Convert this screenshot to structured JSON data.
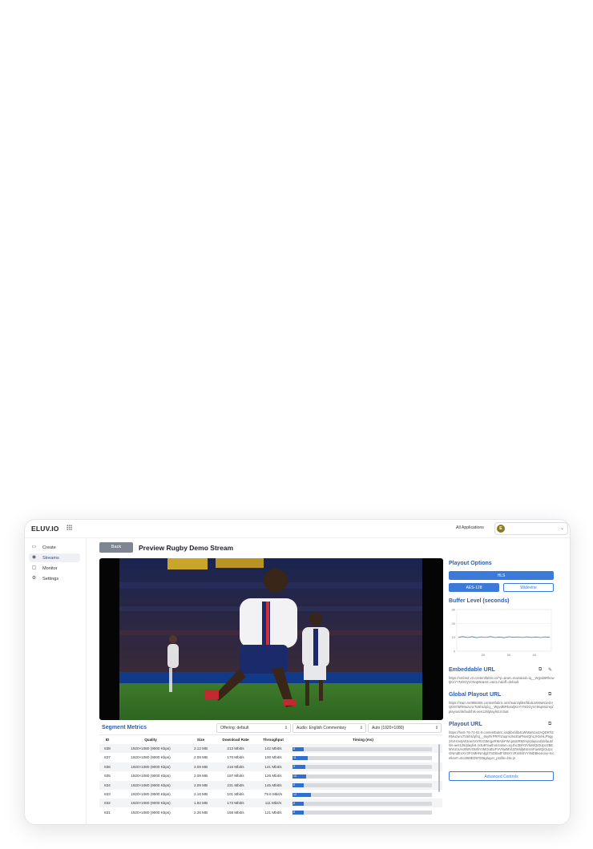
{
  "header": {
    "logo": "ELUV.IO",
    "all_apps": "All Applications",
    "user_initial": "E"
  },
  "sidebar": {
    "items": [
      {
        "label": "Create",
        "icon": "video-camera-icon"
      },
      {
        "label": "Streams",
        "icon": "broadcast-icon"
      },
      {
        "label": "Monitor",
        "icon": "monitor-icon"
      },
      {
        "label": "Settings",
        "icon": "gear-icon"
      }
    ]
  },
  "page": {
    "back_label": "Back",
    "title": "Preview Rugby Demo Stream"
  },
  "metrics": {
    "title": "Segment Metrics",
    "selects": {
      "offering": "Offering: default",
      "audio": "Audio: English Commentary",
      "quality": "Auto (1920×1080)"
    },
    "columns": [
      "ID",
      "Quality",
      "Size",
      "Download Rate",
      "Throughput",
      "Timing (ms)"
    ],
    "rows": [
      {
        "id": "838",
        "quality": "1920×1080 (9000 Kbps)",
        "size": "2.12 MB",
        "rate": "213 Mbit/s",
        "throughput": "142 Mbit/s",
        "timing": 8
      },
      {
        "id": "837",
        "quality": "1920×1080 (9000 Kbps)",
        "size": "2.08 MB",
        "rate": "170 Mbit/s",
        "throughput": "100 Mbit/s",
        "timing": 11
      },
      {
        "id": "836",
        "quality": "1920×1080 (9000 Kbps)",
        "size": "2.09 MB",
        "rate": "216 Mbit/s",
        "throughput": "141 Mbit/s",
        "timing": 9
      },
      {
        "id": "835",
        "quality": "1920×1080 (9000 Kbps)",
        "size": "2.09 MB",
        "rate": "197 Mbit/s",
        "throughput": "126 Mbit/s",
        "timing": 10
      },
      {
        "id": "834",
        "quality": "1920×1080 (9000 Kbps)",
        "size": "2.09 MB",
        "rate": "231 Mbit/s",
        "throughput": "145 Mbit/s",
        "timing": 8
      },
      {
        "id": "833",
        "quality": "1920×1080 (9000 Kbps)",
        "size": "2.16 MB",
        "rate": "101 Mbit/s",
        "throughput": "79.6 Mbit/s",
        "timing": 13
      },
      {
        "id": "832",
        "quality": "1920×1080 (9000 Kbps)",
        "size": "1.92 MB",
        "rate": "173 Mbit/s",
        "throughput": "111 Mbit/s",
        "timing": 8
      },
      {
        "id": "831",
        "quality": "1920×1080 (9000 Kbps)",
        "size": "2.26 MB",
        "rate": "168 Mbit/s",
        "throughput": "121 Mbit/s",
        "timing": 8
      }
    ]
  },
  "playout": {
    "title": "Playout Options",
    "hls_label": "HLS",
    "aes_label": "AES-128",
    "widevine_label": "Widevine"
  },
  "buffer": {
    "title": "Buffer Level (seconds)",
    "chart_data": {
      "type": "line",
      "title": "Buffer Level (seconds)",
      "y_ticks": [
        "30",
        "20",
        "10",
        "0"
      ],
      "x_ticks": [
        "20",
        "30",
        "40"
      ],
      "ylim": [
        0,
        30
      ],
      "series": [
        {
          "values": [
            10,
            10.5,
            9.8,
            10.4,
            9.7,
            10.3,
            9.9,
            10.5,
            9.8,
            10.2,
            9.7,
            10.4,
            10,
            10.3,
            9.8,
            10.4,
            9.9,
            10.2,
            9.8,
            10.3,
            10
          ]
        }
      ]
    }
  },
  "embeddable": {
    "title": "Embeddable URL",
    "url": "https://embed.v3.contentfabric.io/?p=&net=main&oid=iq__WgvdBRkowtjKoYYNOGyVc9vqMo&mt=v&ct=h&off=default"
  },
  "global": {
    "title": "Global Playout URL",
    "url": "https://main.net955305.contentfabric.io/s/main/qlibs/ilib4LWiWaN1eZAQD97i5RMuzuncTc6ihs/q/iq__WgvdBRkowtjKoYYNOGyVc9vqMo/rep/playout/default/hls-aes128/playlist.m3u8"
  },
  "playout_url": {
    "title": "Playout URL",
    "url": "https://host-76-74-91-9.contentfabric.io/qlibs/ilib4LWiWaN1eZAQD97i5RMuzuncTc6ihs/q/hq__9uyRrPRFh2uqmUNcEaPNxsQhLzKtvHLP9gy2sVH3etyW3oeAXVRzG9ergeRMAhiFWcpss8RM/rep/playout/default/hls-aes128/playlist.m3u8?authorization=eyJhc3BlY2VlaWQiOiJpcSBEMVU0UHJ0WVOMhYzMOnBUFVVNwMVlJZWldjMSIsInFtaWQiOiJpcGNmdExXV2FGMHNmbjdYSDBvdFl3NXYzRm9rbVYiNiDBkeecive-IncellaVrr=Eo3I68ED9700&player_profile=hls-js"
  },
  "advanced_label": "Advanced Controls"
}
